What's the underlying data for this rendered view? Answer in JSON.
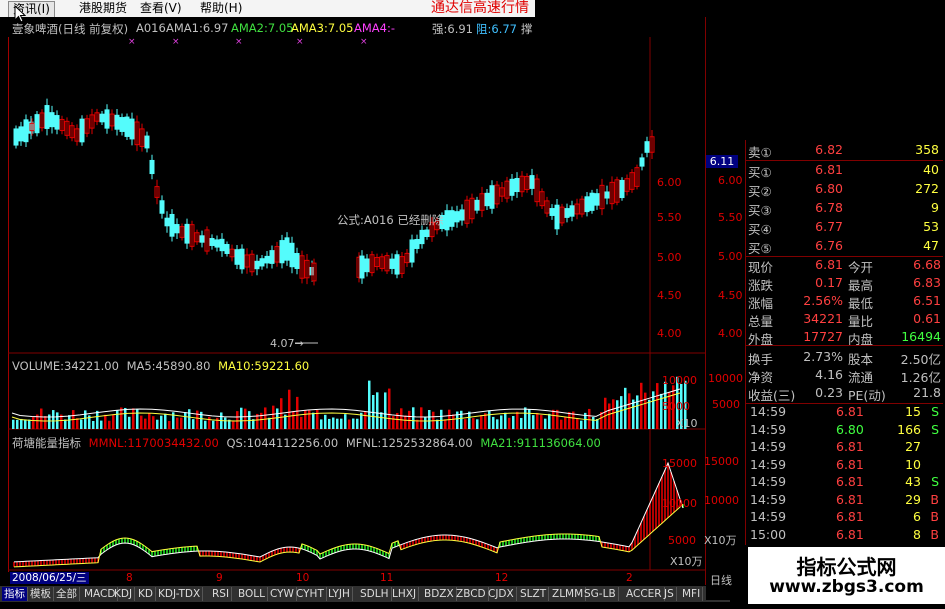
{
  "menubar": {
    "items": [
      "资讯(I)",
      "港股期货",
      "查看(V)",
      "帮助(H)"
    ],
    "promo": "通达信高速行情"
  },
  "infobar": {
    "stock": "壹象啤酒(日线 前复权)",
    "formula": "A016",
    "ama1": "AMA1:6.97",
    "ama2": "AMA2:7.05",
    "ama3": "AMA3:7.05",
    "ama4": "AMA4:-",
    "strong": "强:6.91",
    "resist": "阻:6.77",
    "extra": "撑"
  },
  "price_panel": {
    "message": "公式:A016 已经删除",
    "arrow_label": "4.07→",
    "current_tag": "6.11",
    "axis": [
      "6.00",
      "5.50",
      "5.00",
      "4.50",
      "4.00"
    ]
  },
  "volume_panel": {
    "volume": "VOLUME:34221.00",
    "ma5": "MA5:45890.80",
    "ma10": "MA10:59221.60",
    "axis": [
      "10000",
      "5000"
    ],
    "unit": "X10"
  },
  "energy_panel": {
    "name": "荷塘能量指标",
    "mmnl": "MMNL:1170034432.00",
    "qs": "QS:1044112256.00",
    "mfnl": "MFNL:1252532864.00",
    "ma21": "MA21:911136064.00",
    "axis": [
      "15000",
      "10000",
      "5000"
    ],
    "unit": "X10万"
  },
  "date_strip": {
    "current": "2008/06/25/三",
    "months": [
      "8",
      "9",
      "10",
      "11",
      "12",
      "2"
    ],
    "period": "日线"
  },
  "tabs": [
    "指标",
    "模板",
    "全部",
    "MACD",
    "KDJ",
    "KD",
    "KDJ-TDX",
    "RSI",
    "BOLL",
    "CYW",
    "CYHT",
    "LYJH",
    "SDLH",
    "LHXJ",
    "BDZX",
    "ZBCD",
    "CJDX",
    "SLZT",
    "ZLMM",
    "SG-LB",
    "ACCER",
    "JS",
    "MFI"
  ],
  "quotes": {
    "sell": [
      {
        "label": "卖①",
        "price": "6.82",
        "vol": "358"
      }
    ],
    "buy": [
      {
        "label": "买①",
        "price": "6.81",
        "vol": "40"
      },
      {
        "label": "买②",
        "price": "6.80",
        "vol": "272"
      },
      {
        "label": "买③",
        "price": "6.78",
        "vol": "9"
      },
      {
        "label": "买④",
        "price": "6.77",
        "vol": "53"
      },
      {
        "label": "买⑤",
        "price": "6.76",
        "vol": "47"
      }
    ]
  },
  "stats": [
    {
      "l1": "现价",
      "v1": "6.81",
      "l2": "今开",
      "v2": "6.68"
    },
    {
      "l1": "涨跌",
      "v1": "0.17",
      "l2": "最高",
      "v2": "6.83"
    },
    {
      "l1": "涨幅",
      "v1": "2.56%",
      "l2": "最低",
      "v2": "6.51"
    },
    {
      "l1": "总量",
      "v1": "34221",
      "l2": "量比",
      "v2": "0.61"
    },
    {
      "l1": "外盘",
      "v1": "17727",
      "l2": "内盘",
      "v2": "16494"
    }
  ],
  "stats2": [
    {
      "l1": "换手",
      "v1": "2.73%",
      "l2": "股本",
      "v2": "2.50亿"
    },
    {
      "l1": "净资",
      "v1": "4.16",
      "l2": "流通",
      "v2": "1.26亿"
    },
    {
      "l1": "收益(三)",
      "v1": "0.23",
      "l2": "PE(动)",
      "v2": "21.8"
    }
  ],
  "trades": [
    {
      "time": "14:59",
      "price": "6.81",
      "qty": "15",
      "side": "S"
    },
    {
      "time": "14:59",
      "price": "6.80",
      "qty": "166",
      "side": "S"
    },
    {
      "time": "14:59",
      "price": "6.81",
      "qty": "27",
      "side": ""
    },
    {
      "time": "14:59",
      "price": "6.81",
      "qty": "10",
      "side": ""
    },
    {
      "time": "14:59",
      "price": "6.81",
      "qty": "43",
      "side": "S"
    },
    {
      "time": "14:59",
      "price": "6.81",
      "qty": "29",
      "side": "B"
    },
    {
      "time": "14:59",
      "price": "6.81",
      "qty": "6",
      "side": "B"
    },
    {
      "time": "15:00",
      "price": "6.81",
      "qty": "8",
      "side": "B"
    }
  ],
  "brand": {
    "line1": "指标公式网",
    "line2": "www.zbgs3.com"
  },
  "colors": {
    "up": "#e00000",
    "down": "#54fcfc",
    "accent": "#ffff40"
  }
}
